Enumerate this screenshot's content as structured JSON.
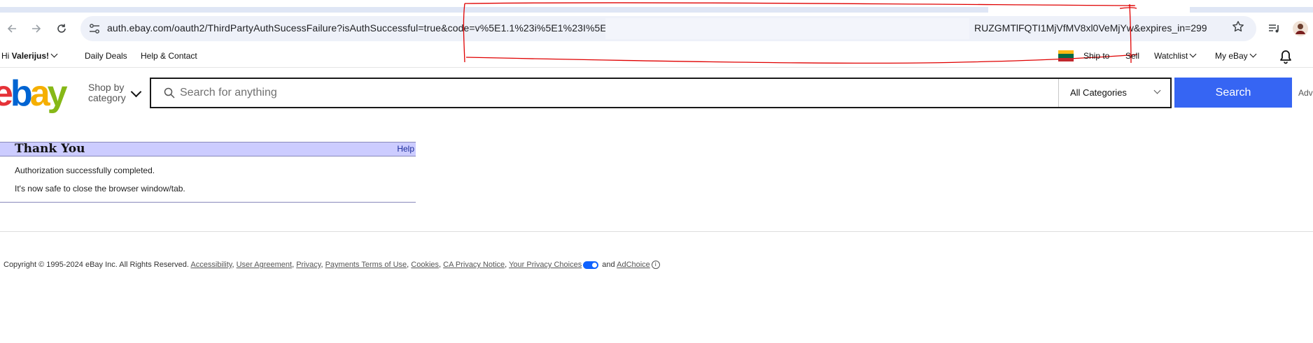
{
  "browser": {
    "url_left": "auth.ebay.com/oauth2/ThirdPartyAuthSucessFailure?isAuthSuccessful=true&code=v%5E1.1%23i%5E1%23I%5E3%23",
    "url_right": "RUZGMTlFQTI1MjVfMV8xl0VeMjYw&expires_in=299",
    "icons": {
      "back": "arrow-left-icon",
      "forward": "arrow-right-icon",
      "reload": "reload-icon",
      "site_info": "tune-icon",
      "bookmark": "star-icon",
      "media": "media-control-icon",
      "profile": "profile-avatar-icon"
    },
    "annotation_color": "#e00000"
  },
  "topnav": {
    "greeting_prefix": "Hi ",
    "user": "Valerijus!",
    "daily_deals": "Daily Deals",
    "help_contact": "Help & Contact",
    "ship_to": "Ship to",
    "sell": "Sell",
    "watchlist": "Watchlist",
    "my_ebay": "My eBay",
    "flag_colors": [
      "#fdb913",
      "#006a44",
      "#c1272d"
    ]
  },
  "header": {
    "logo": {
      "letters": [
        "e",
        "b",
        "a",
        "y"
      ],
      "colors": [
        "#e53238",
        "#0064d2",
        "#f5af02",
        "#86b817"
      ]
    },
    "shop_by": "Shop by",
    "category": "category",
    "search_placeholder": "Search for anything",
    "category_select": "All Categories",
    "search_button": "Search",
    "advanced": "Adv",
    "accent": "#3665f3"
  },
  "panel": {
    "title": "Thank You",
    "help": "Help",
    "message1": "Authorization successfully completed.",
    "message2": "It's now safe to close the browser window/tab.",
    "header_bg": "#ccccff"
  },
  "footer": {
    "copyright": "Copyright © 1995-2024 eBay Inc. All Rights Reserved.",
    "links": [
      "Accessibility",
      "User Agreement",
      "Privacy",
      "Payments Terms of Use",
      "Cookies",
      "CA Privacy Notice",
      "Your Privacy Choices"
    ],
    "and": "and",
    "adchoice": "AdChoice"
  }
}
